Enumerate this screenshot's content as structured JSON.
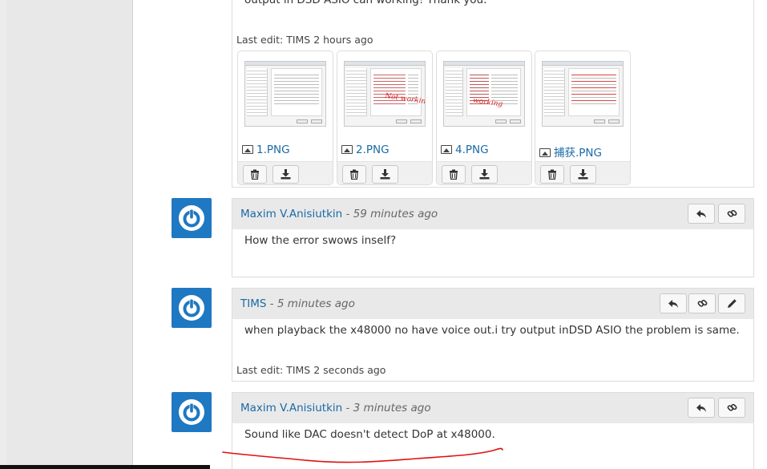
{
  "top_post": {
    "cut_text": "output in DSD ASIO can working! Thank you.",
    "last_edit": "Last edit: TIMS 2 hours ago",
    "attachments": [
      {
        "name": "1.PNG",
        "scribble": ""
      },
      {
        "name": "2.PNG",
        "scribble": "Not working"
      },
      {
        "name": "4.PNG",
        "scribble": "working"
      },
      {
        "name": "捕获.PNG",
        "scribble": ""
      }
    ],
    "delete_icon": "trash-icon",
    "download_icon": "download-icon"
  },
  "comments": [
    {
      "author": "Maxim V.Anisiutkin",
      "separator": " - ",
      "time": "59 minutes ago",
      "body": "How the error swows inself?",
      "last_edit": ""
    },
    {
      "author": "TIMS",
      "separator": " - ",
      "time": "5 minutes ago",
      "body": "when playback the x48000 no have voice out.i try output inDSD ASIO the problem is same.",
      "last_edit": "Last edit: TIMS 2 seconds ago"
    },
    {
      "author": "Maxim V.Anisiutkin",
      "separator": " - ",
      "time": "3 minutes ago",
      "body": "Sound like DAC doesn't detect DoP at x48000.",
      "last_edit": ""
    }
  ],
  "icons": {
    "reply": "reply-icon",
    "link": "link-icon",
    "edit": "pencil-icon",
    "avatar": "power-icon"
  },
  "colors": {
    "link": "#1a6aa6",
    "avatar_bg": "#1f78c2",
    "annotation_red": "#e01010"
  }
}
